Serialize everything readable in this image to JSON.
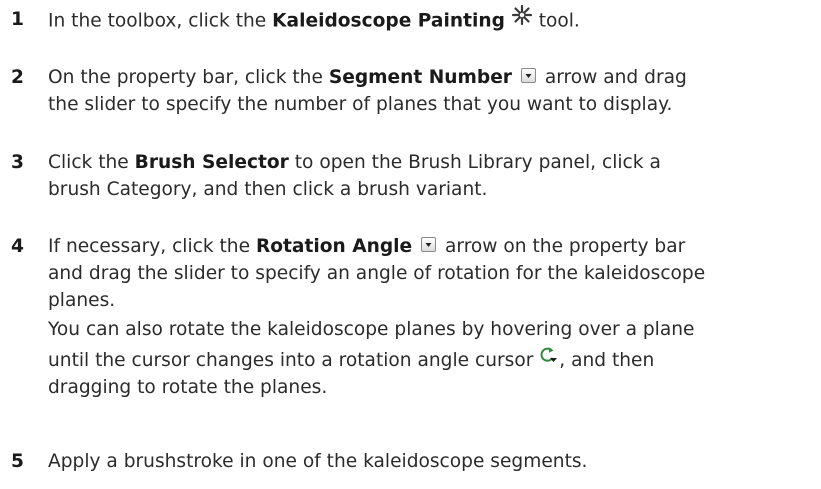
{
  "steps": [
    {
      "number": "1",
      "lines": [
        {
          "pre": "In the toolbox, click the ",
          "bold": "Kaleidoscope Painting",
          "post": " tool."
        }
      ],
      "icon": "kaleidoscope-icon"
    },
    {
      "number": "2",
      "line1_pre": "On the property bar, click the ",
      "line1_bold": "Segment Number",
      "line1_post": " arrow and drag",
      "line2": "the slider to specify the number of planes that you want to display.",
      "icon": "dropdown-arrow-icon"
    },
    {
      "number": "3",
      "line1_pre": "Click the ",
      "line1_bold": "Brush Selector",
      "line1_post": " to open the Brush Library panel, click a",
      "line2": "brush Category, and then click a brush variant."
    },
    {
      "number": "4",
      "line1_pre": "If necessary, click the ",
      "line1_bold": "Rotation Angle",
      "line1_post": " arrow on the property bar",
      "line2": "and drag the slider to specify an angle of rotation for the kaleidoscope",
      "line3": "planes.",
      "note_line1": "You can also rotate the kaleidoscope planes by hovering over a plane",
      "note_line2_pre": "until the cursor changes into a rotation angle cursor ",
      "note_line2_post": ", and then",
      "note_line3": "dragging to rotate the planes.",
      "icons": [
        "dropdown-arrow-icon",
        "rotation-cursor-icon"
      ]
    },
    {
      "number": "5",
      "line1": "Apply a brushstroke in one of the kaleidoscope segments."
    }
  ],
  "colors": {
    "text": "#2b2b2b",
    "accent_green": "#2e8b3a"
  }
}
